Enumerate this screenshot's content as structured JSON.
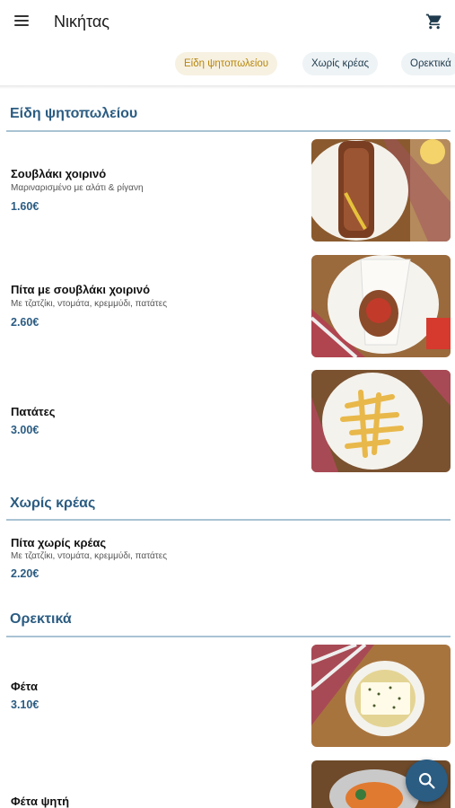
{
  "header": {
    "title": "Νικήτας",
    "menu_icon": "hamburger-icon",
    "cart_icon": "cart-icon"
  },
  "categories": [
    {
      "label": "Είδη ψητοπωλείου",
      "active": true
    },
    {
      "label": "Χωρίς κρέας",
      "active": false
    },
    {
      "label": "Ορεκτικά",
      "active": false
    }
  ],
  "sections": [
    {
      "title": "Είδη ψητοπωλείου",
      "items": [
        {
          "name": "Σουβλάκι χοιρινό",
          "description": "Μαριναρισμένο με αλάτι & ρίγανη",
          "price": "1.60€"
        },
        {
          "name": "Πίτα με σουβλάκι χοιρινό",
          "description": "Με τζατζίκι, ντομάτα, κρεμμύδι, πατάτες",
          "price": "2.60€"
        },
        {
          "name": "Πατάτες",
          "description": "",
          "price": "3.00€"
        }
      ]
    },
    {
      "title": "Χωρίς κρέας",
      "items": [
        {
          "name": "Πίτα χωρίς κρέας",
          "description": "Με τζατζίκι, ντομάτα, κρεμμύδι, πατάτες",
          "price": "2.20€"
        }
      ]
    },
    {
      "title": "Ορεκτικά",
      "items": [
        {
          "name": "Φέτα",
          "description": "",
          "price": "3.10€"
        },
        {
          "name": "Φέτα ψητή",
          "description": "",
          "price": ""
        }
      ]
    }
  ],
  "fab": {
    "icon": "search-icon"
  },
  "colors": {
    "accent": "#2b5c82",
    "active_chip_text": "#b8860b",
    "active_chip_bg": "#f7f1e2",
    "inactive_chip_bg": "#eef3f6",
    "divider": "#a9c3d3"
  }
}
